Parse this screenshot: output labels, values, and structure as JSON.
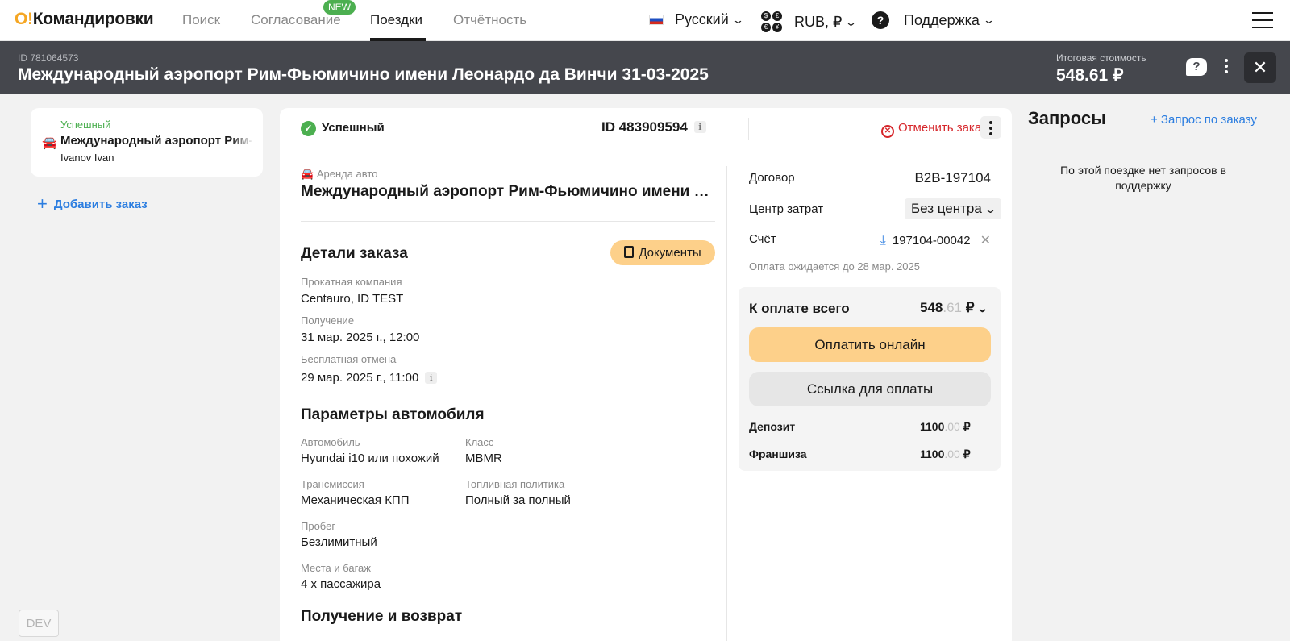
{
  "nav": {
    "logo_mark": "O!",
    "logo_text": "Командировки",
    "links": [
      "Поиск",
      "Согласование",
      "Поездки",
      "Отчётность"
    ],
    "new_badge": "NEW",
    "language": "Русский",
    "currency": "RUB, ₽",
    "support": "Поддержка",
    "currency_icon_symbols": [
      "$",
      "£",
      "€",
      "¥"
    ]
  },
  "trip": {
    "id_label": "ID 781064573",
    "title": "Международный аэропорт Рим-Фьюмичино имени Леонардо да Винчи 31-03-2025",
    "total_label": "Итоговая стоимость",
    "total_value": "548.61 ₽",
    "chat_icon": "?",
    "close_icon": "✕"
  },
  "sidebar": {
    "card": {
      "status": "Успешный",
      "title": "Международный аэропорт Рим-Фьюмичино имени Леонардо да Винчи",
      "traveler": "Ivanov Ivan"
    },
    "add_order": "Добавить заказ",
    "add_icon": "+",
    "dev_badge": "DEV"
  },
  "order": {
    "status": "Успешный",
    "status_icon": "✓",
    "id": "ID 483909594",
    "info_icon": "i",
    "cancel": "Отменить заказ",
    "cancel_icon": "✕",
    "service_label": "Аренда авто",
    "service_title": "Международный аэропорт Рим-Фьюмичино имени Леонардо да Винчи",
    "details_heading": "Детали заказа",
    "documents_button": "Документы",
    "details": {
      "company_label": "Прокатная компания",
      "company_value": "Centauro, ID TEST",
      "pickup_label": "Получение",
      "pickup_value": "31 мар. 2025 г., 12:00",
      "free_cancel_label": "Бесплатная отмена",
      "free_cancel_value": "29 мар. 2025 г., 11:00"
    },
    "car_heading": "Параметры автомобиля",
    "car": {
      "model_label": "Автомобиль",
      "model_value": "Hyundai i10 или похожий",
      "class_label": "Класс",
      "class_value": "MBMR",
      "transmission_label": "Трансмиссия",
      "transmission_value": "Механическая КПП",
      "fuel_label": "Топливная политика",
      "fuel_value": "Полный за полный",
      "mileage_label": "Пробег",
      "mileage_value": "Безлимитный",
      "seats_label": "Места и багаж",
      "seats_value": "4 x пассажира"
    },
    "return_heading": "Получение и возврат"
  },
  "billing": {
    "contract_label": "Договор",
    "contract_value": "B2B-197104",
    "cost_center_label": "Центр затрат",
    "cost_center_value": "Без центра",
    "invoice_label": "Счёт",
    "invoice_value": "197104-00042",
    "download_icon": "⤓",
    "remove_icon": "✕",
    "pay_until": "Оплата ожидается до 28 мар. 2025",
    "total_label": "К оплате всего",
    "total_int": "548",
    "total_dec": ".61",
    "currency": "₽",
    "pay_online": "Оплатить онлайн",
    "pay_link": "Ссылка для оплаты",
    "deposit_label": "Депозит",
    "deposit_int": "1100",
    "deposit_dec": ".00",
    "franchise_label": "Франшиза",
    "franchise_int": "1100",
    "franchise_dec": ".00"
  },
  "requests": {
    "title": "Запросы",
    "add": "+ Запрос по заказу",
    "empty": "По этой поездке нет запросов в поддержку"
  }
}
